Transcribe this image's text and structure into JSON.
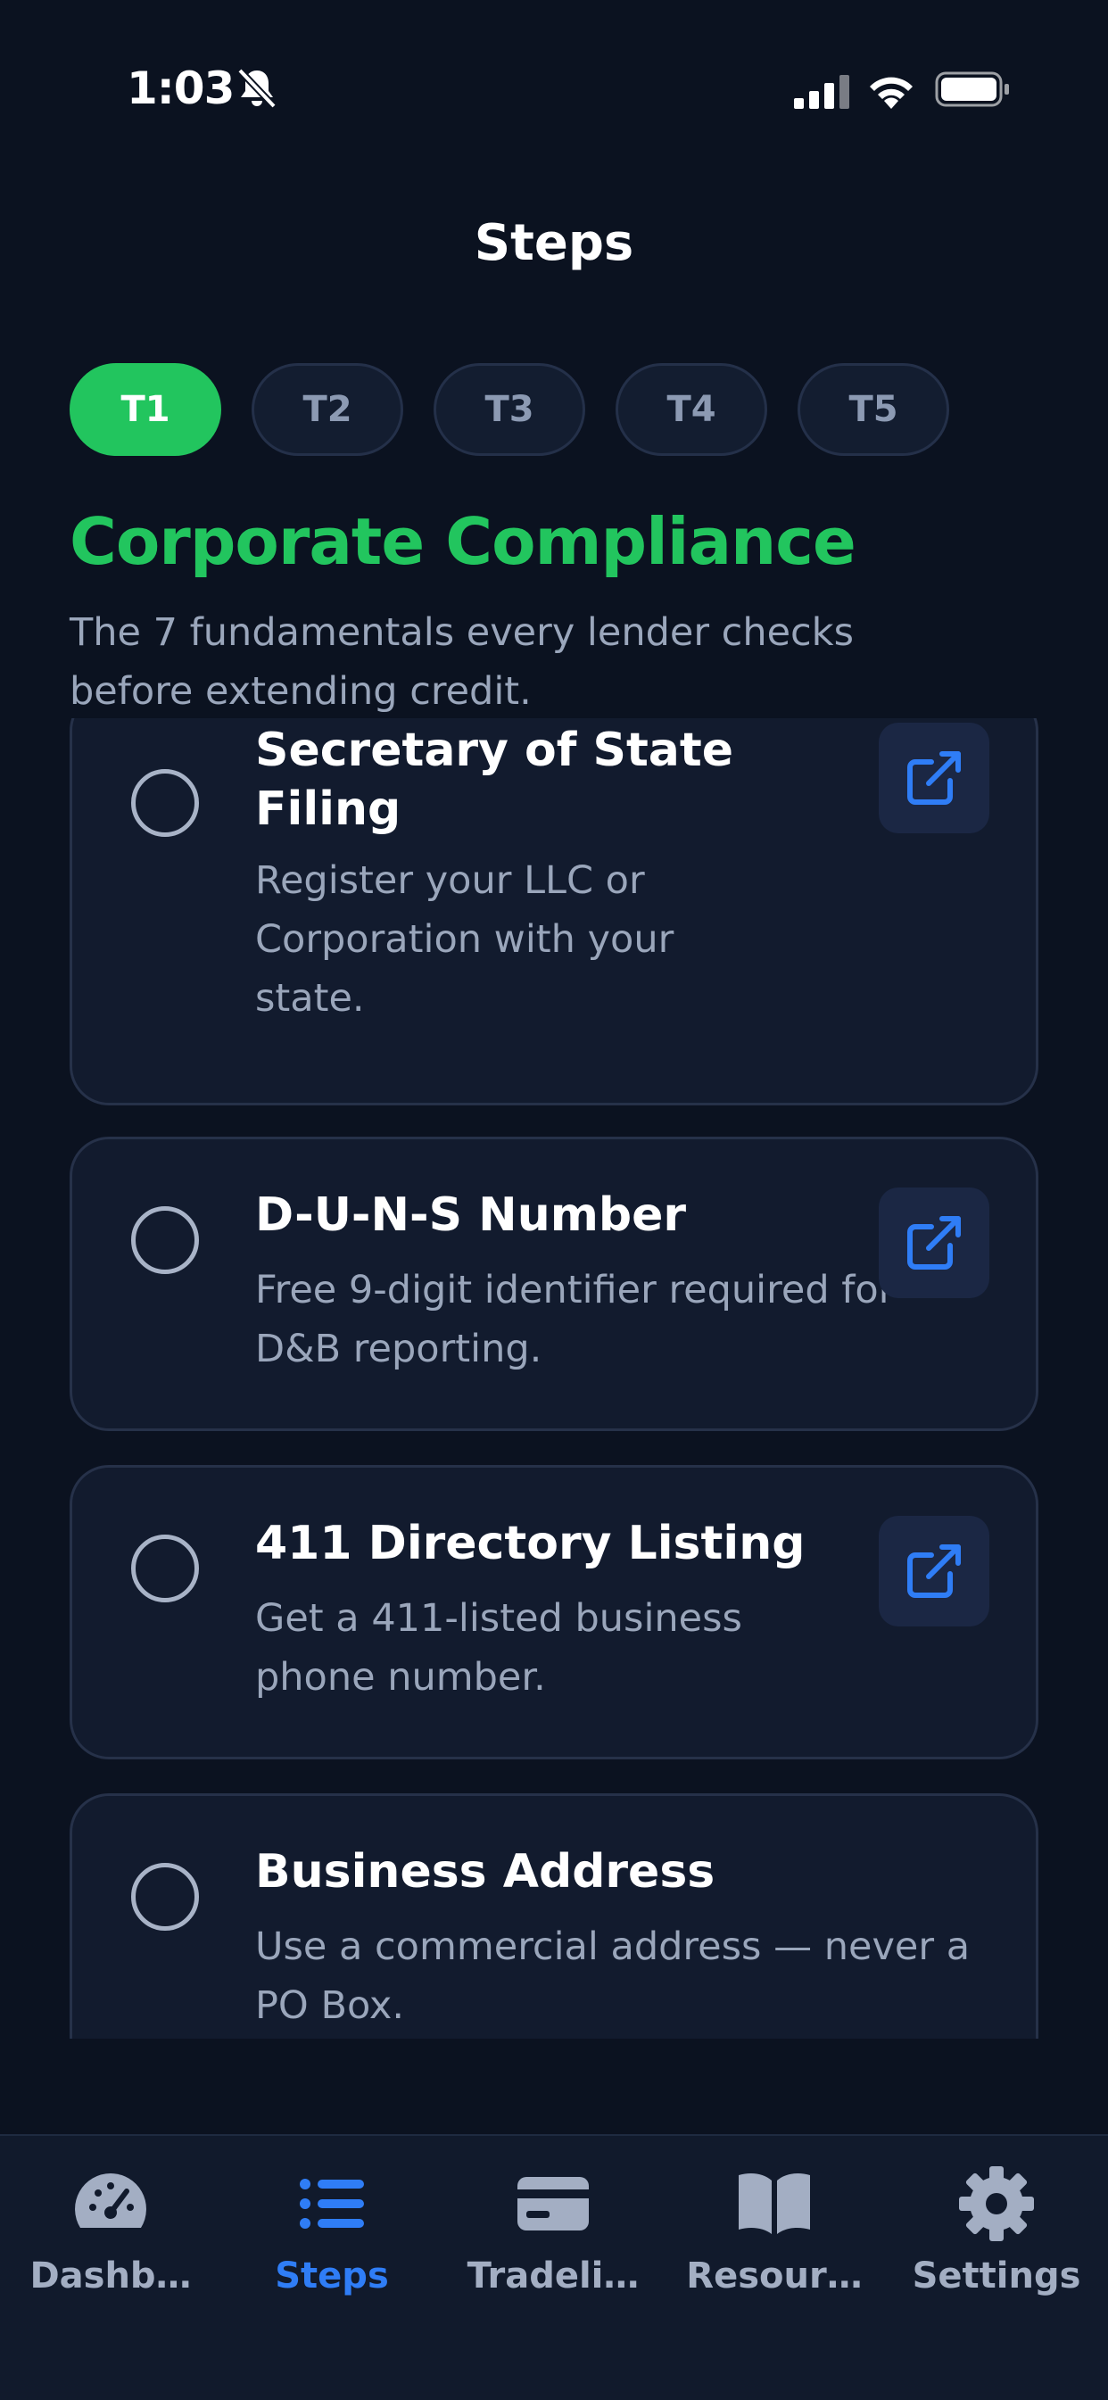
{
  "status_bar": {
    "time": "1:03"
  },
  "header": {
    "title": "Steps"
  },
  "tier_tabs": [
    {
      "label": "T1",
      "active": true
    },
    {
      "label": "T2",
      "active": false
    },
    {
      "label": "T3",
      "active": false
    },
    {
      "label": "T4",
      "active": false
    },
    {
      "label": "T5",
      "active": false
    }
  ],
  "section": {
    "title": "Corporate Compliance",
    "description": "The 7 fundamentals every lender checks before extending credit."
  },
  "steps": [
    {
      "title": "Secretary of State Filing",
      "description": "Register your LLC or Corporation with your state.",
      "has_link": true,
      "checked": false
    },
    {
      "title": "D-U-N-S Number",
      "description": "Free 9-digit identifier required for D&B reporting.",
      "has_link": true,
      "checked": false
    },
    {
      "title": "411 Directory Listing",
      "description": "Get a 411-listed business phone number.",
      "has_link": true,
      "checked": false
    },
    {
      "title": "Business Address",
      "description": "Use a commercial address — never a PO Box.",
      "has_link": false,
      "checked": false
    }
  ],
  "tab_bar": [
    {
      "label": "Dashb…",
      "icon": "gauge-icon",
      "active": false
    },
    {
      "label": "Steps",
      "icon": "list-icon",
      "active": true
    },
    {
      "label": "Tradeli…",
      "icon": "credit-card-icon",
      "active": false
    },
    {
      "label": "Resour…",
      "icon": "book-icon",
      "active": false
    },
    {
      "label": "Settings",
      "icon": "gear-icon",
      "active": false
    }
  ],
  "colors": {
    "background": "#0b1220",
    "accent_green": "#22c55e",
    "accent_blue": "#2f7df6",
    "card": "#121b2e",
    "muted_text": "#9aa6bb"
  }
}
